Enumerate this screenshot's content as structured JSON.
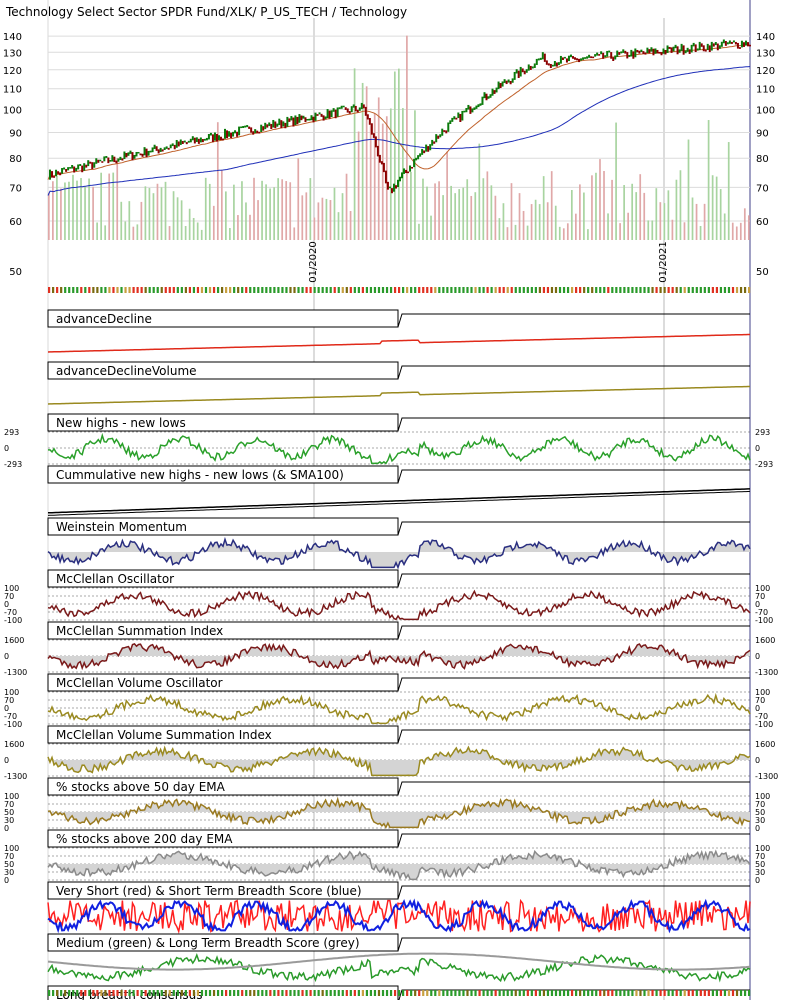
{
  "chart_data": {
    "type": "line",
    "title": "Technology Select Sector SPDR Fund/XLK/ P_US_TECH / Technology",
    "date_labels": [
      "01/2020",
      "01/2021"
    ],
    "colors": {
      "price_up": "#0b7a0b",
      "price_down": "#8b0000",
      "sma_fast": "#c0622c",
      "sma_slow": "#1f2fb8",
      "volume_up": "#a8d4a0",
      "volume_down": "#e0a8a8",
      "advance_decline": "#e02a1a",
      "olive": "#9a8a20",
      "nhnl": "#2aa02a",
      "weinstein": "#2a2f80",
      "mcclellan": "#7a1a1a",
      "grey": "#8a8a8a",
      "very_short": "#ff2020",
      "short": "#1020e0",
      "medium": "#2a9a2a",
      "long": "#9a9a9a"
    },
    "price_panel": {
      "yticks": [
        140,
        130,
        120,
        110,
        100,
        90,
        80,
        70,
        60,
        50
      ],
      "yscale": "log",
      "ylim": [
        50,
        150
      ]
    },
    "panels": [
      {
        "title": "advanceDecline",
        "color": "#e02a1a",
        "ticks": []
      },
      {
        "title": "advanceDeclineVolume",
        "color": "#9a8a20",
        "ticks": []
      },
      {
        "title": "New highs - new lows",
        "color": "#2aa02a",
        "ticks": [
          "293",
          "0",
          "-293"
        ]
      },
      {
        "title": "Cummulative new highs - new lows (& SMA100)",
        "color": "#000000",
        "ticks": []
      },
      {
        "title": "Weinstein Momentum",
        "color": "#2a2f80",
        "ticks": []
      },
      {
        "title": "McClellan Oscillator",
        "color": "#7a1a1a",
        "ticks": [
          "100",
          "70",
          "0",
          "-70",
          "-100"
        ]
      },
      {
        "title": "McClellan Summation Index",
        "color": "#7a1a1a",
        "ticks": [
          "1600",
          "0",
          "-1300"
        ]
      },
      {
        "title": "McClellan Volume Oscillator",
        "color": "#9a8a20",
        "ticks": [
          "100",
          "70",
          "0",
          "-70",
          "-100"
        ]
      },
      {
        "title": "McClellan Volume Summation Index",
        "color": "#9a8a20",
        "ticks": [
          "1600",
          "0",
          "-1300"
        ]
      },
      {
        "title": "% stocks above 50 day EMA",
        "color": "#9a7a20",
        "ticks": [
          "100",
          "70",
          "50",
          "30",
          "0"
        ]
      },
      {
        "title": "% stocks above 200 day EMA",
        "color": "#8a8a8a",
        "ticks": [
          "100",
          "70",
          "50",
          "30",
          "0"
        ]
      },
      {
        "title": "Very Short (red) & Short Term Breadth Score (blue)",
        "color": "#ff2020",
        "ticks": []
      },
      {
        "title": "Medium (green) & Long Term Breadth Score (grey)",
        "color": "#2a9a2a",
        "ticks": []
      },
      {
        "title": "Long breadth consensus",
        "color": "#000000",
        "ticks": []
      }
    ]
  }
}
